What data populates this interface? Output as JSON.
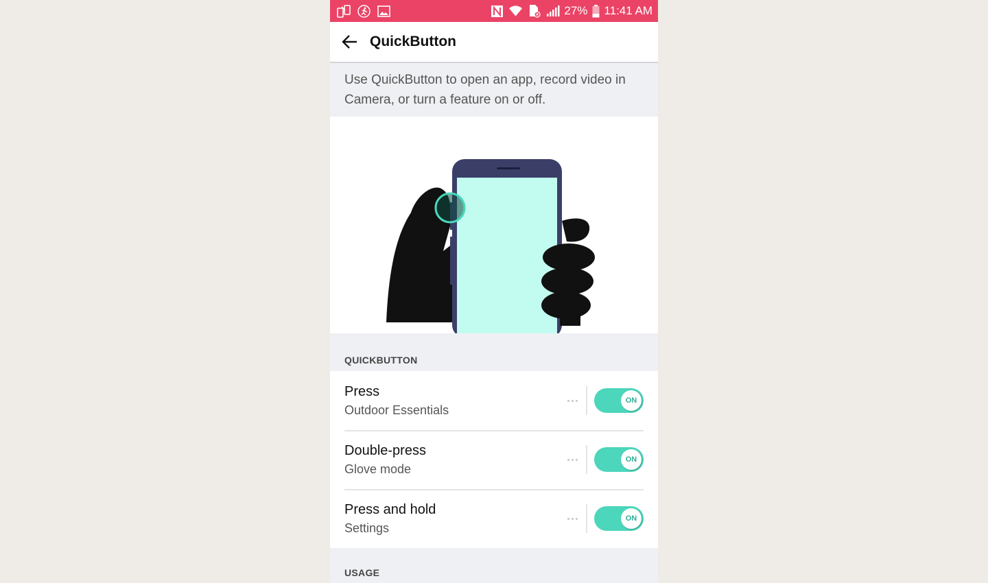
{
  "status_bar": {
    "left_icons": [
      "screen-mirror-icon",
      "running-man-icon",
      "gallery-icon"
    ],
    "right_icons": [
      "nfc-icon",
      "wifi-icon",
      "sim-error-icon",
      "signal-icon"
    ],
    "battery": "27%",
    "time": "11:41 AM",
    "color": "#ea4366"
  },
  "app_bar": {
    "back_icon": "arrow-left-icon",
    "title": "QuickButton"
  },
  "description": "Use QuickButton to open an app, record video in Camera, or turn a feature on or off.",
  "illustration": {
    "subject": "gloved hand pressing side button of phone",
    "accent": "#4cd6bb",
    "screen_color": "#c2fbef",
    "phone_color": "#3b3f68"
  },
  "sections": [
    {
      "header": "QUICKBUTTON",
      "items": [
        {
          "title": "Press",
          "subtitle": "Outdoor Essentials",
          "toggle": "ON"
        },
        {
          "title": "Double-press",
          "subtitle": "Glove mode",
          "toggle": "ON"
        },
        {
          "title": "Press and hold",
          "subtitle": "Settings",
          "toggle": "ON"
        }
      ]
    },
    {
      "header": "USAGE",
      "items": []
    }
  ],
  "accent_color": "#4cd6bb"
}
